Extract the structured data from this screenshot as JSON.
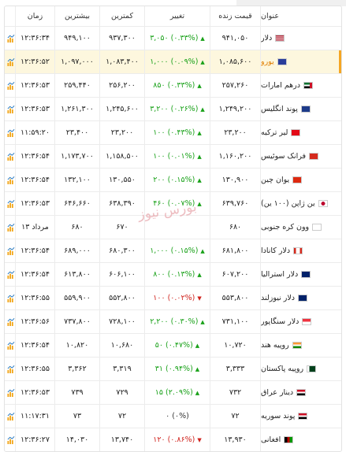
{
  "header": {
    "name": "عنوان",
    "price": "قیمت زنده",
    "change": "تغییر",
    "low": "کمترین",
    "high": "بیشترین",
    "time": "زمان"
  },
  "watermark": "بورس نیوز",
  "colors": {
    "up": "#19a119",
    "down": "#d0231d",
    "highlight": "#fdf7de",
    "accent": "#f5a623"
  },
  "rows": [
    {
      "name": "دلار",
      "flag": "us",
      "price": "۹۴۱,۰۵۰",
      "change": "۳,۰۵۰ (۰.۳۳%)",
      "dir": "up",
      "low": "۹۳۷,۳۰۰",
      "high": "۹۴۹,۱۰۰",
      "time": "۱۲:۳۶:۳۴"
    },
    {
      "name": "یورو",
      "flag": "eu",
      "price": "۱,۰۸۵,۶۰۰",
      "change": "۱,۰۰۰ (۰.۰۹%)",
      "dir": "up",
      "low": "۱,۰۸۳,۴۰۰",
      "high": "۱,۰۹۷,۰۰۰",
      "time": "۱۲:۳۶:۵۲",
      "highlight": true
    },
    {
      "name": "درهم امارات",
      "flag": "ae",
      "price": "۲۵۷,۲۶۰",
      "change": "۸۵۰ (۰.۳۳%)",
      "dir": "up",
      "low": "۲۵۶,۲۰۰",
      "high": "۲۵۹,۴۴۰",
      "time": "۱۲:۳۶:۵۳"
    },
    {
      "name": "پوند انگلیس",
      "flag": "gb",
      "price": "۱,۲۴۹,۲۰۰",
      "change": "۳,۲۰۰ (۰.۲۶%)",
      "dir": "up",
      "low": "۱,۲۴۵,۶۰۰",
      "high": "۱,۲۶۱,۳۰۰",
      "time": "۱۲:۳۶:۵۳"
    },
    {
      "name": "لیر ترکیه",
      "flag": "tr",
      "price": "۲۳,۲۰۰",
      "change": "۱۰۰ (۰.۴۳%)",
      "dir": "up",
      "low": "۲۳,۲۰۰",
      "high": "۲۳,۴۰۰",
      "time": "۱۱:۵۹:۲۰"
    },
    {
      "name": "فرانک سوئیس",
      "flag": "ch",
      "price": "۱,۱۶۰,۲۰۰",
      "change": "۱۰۰ (۰.۰۱%)",
      "dir": "up",
      "low": "۱,۱۵۸,۵۰۰",
      "high": "۱,۱۷۳,۷۰۰",
      "time": "۱۲:۳۶:۵۴"
    },
    {
      "name": "یوان چین",
      "flag": "cn",
      "price": "۱۳۰,۹۰۰",
      "change": "۲۰۰ (۰.۱۵%)",
      "dir": "up",
      "low": "۱۳۰,۵۵۰",
      "high": "۱۳۲,۱۰۰",
      "time": "۱۲:۳۶:۵۴"
    },
    {
      "name": "ین ژاپن (۱۰۰ ین)",
      "flag": "jp",
      "price": "۶۳۹,۷۶۰",
      "change": "۴۶۰ (۰.۰۷%)",
      "dir": "up",
      "low": "۶۳۸,۳۹۰",
      "high": "۶۴۶,۶۶۰",
      "time": "۱۲:۳۶:۵۳"
    },
    {
      "name": "وون کره جنوبی",
      "flag": "kr",
      "price": "۶۸۰",
      "change": "",
      "dir": "neutral",
      "low": "۶۷۰",
      "high": "۶۸۰",
      "time": "۱۳ مرداد"
    },
    {
      "name": "دلار کانادا",
      "flag": "ca",
      "price": "۶۸۱,۸۰۰",
      "change": "۱,۰۰۰ (۰.۱۵%)",
      "dir": "up",
      "low": "۶۸۰,۳۰۰",
      "high": "۶۸۹,۰۰۰",
      "time": "۱۲:۳۶:۵۴"
    },
    {
      "name": "دلار استرالیا",
      "flag": "au",
      "price": "۶۰۷,۲۰۰",
      "change": "۸۰۰ (۰.۱۳%)",
      "dir": "up",
      "low": "۶۰۶,۱۰۰",
      "high": "۶۱۳,۸۰۰",
      "time": "۱۲:۳۶:۵۴"
    },
    {
      "name": "دلار نیوزلند",
      "flag": "nz",
      "price": "۵۵۳,۸۰۰",
      "change": "۱۰۰ (۰.۰۲%)",
      "dir": "down",
      "low": "۵۵۲,۸۰۰",
      "high": "۵۵۹,۹۰۰",
      "time": "۱۲:۳۶:۵۵"
    },
    {
      "name": "دلار سنگاپور",
      "flag": "sg",
      "price": "۷۳۱,۱۰۰",
      "change": "۲,۲۰۰ (۰.۳۰%)",
      "dir": "up",
      "low": "۷۲۸,۱۰۰",
      "high": "۷۳۷,۸۰۰",
      "time": "۱۲:۳۶:۵۶"
    },
    {
      "name": "روپیه هند",
      "flag": "in",
      "price": "۱۰,۷۲۰",
      "change": "۵۰ (۰.۴۷%)",
      "dir": "up",
      "low": "۱۰,۶۸۰",
      "high": "۱۰,۸۲۰",
      "time": "۱۲:۳۶:۵۴"
    },
    {
      "name": "روپیه پاکستان",
      "flag": "pk",
      "price": "۳,۳۳۳",
      "change": "۳۱ (۰.۹۴%)",
      "dir": "up",
      "low": "۳,۳۱۹",
      "high": "۳,۳۶۲",
      "time": "۱۲:۳۶:۵۵"
    },
    {
      "name": "دینار عراق",
      "flag": "iq",
      "price": "۷۳۲",
      "change": "۱۵ (۲.۰۹%)",
      "dir": "up",
      "low": "۷۲۹",
      "high": "۷۳۹",
      "time": "۱۲:۳۶:۵۳"
    },
    {
      "name": "پوند سوریه",
      "flag": "sy",
      "price": "۷۲",
      "change": "۰ (۰%)",
      "dir": "neutral",
      "low": "۷۲",
      "high": "۷۳",
      "time": "۱۱:۱۷:۳۱"
    },
    {
      "name": "افغانی",
      "flag": "af",
      "price": "۱۳,۹۳۰",
      "change": "۱۲۰ (۰.۸۶%)",
      "dir": "down",
      "low": "۱۳,۷۴۰",
      "high": "۱۴,۰۳۰",
      "time": "۱۲:۳۶:۲۷"
    }
  ]
}
